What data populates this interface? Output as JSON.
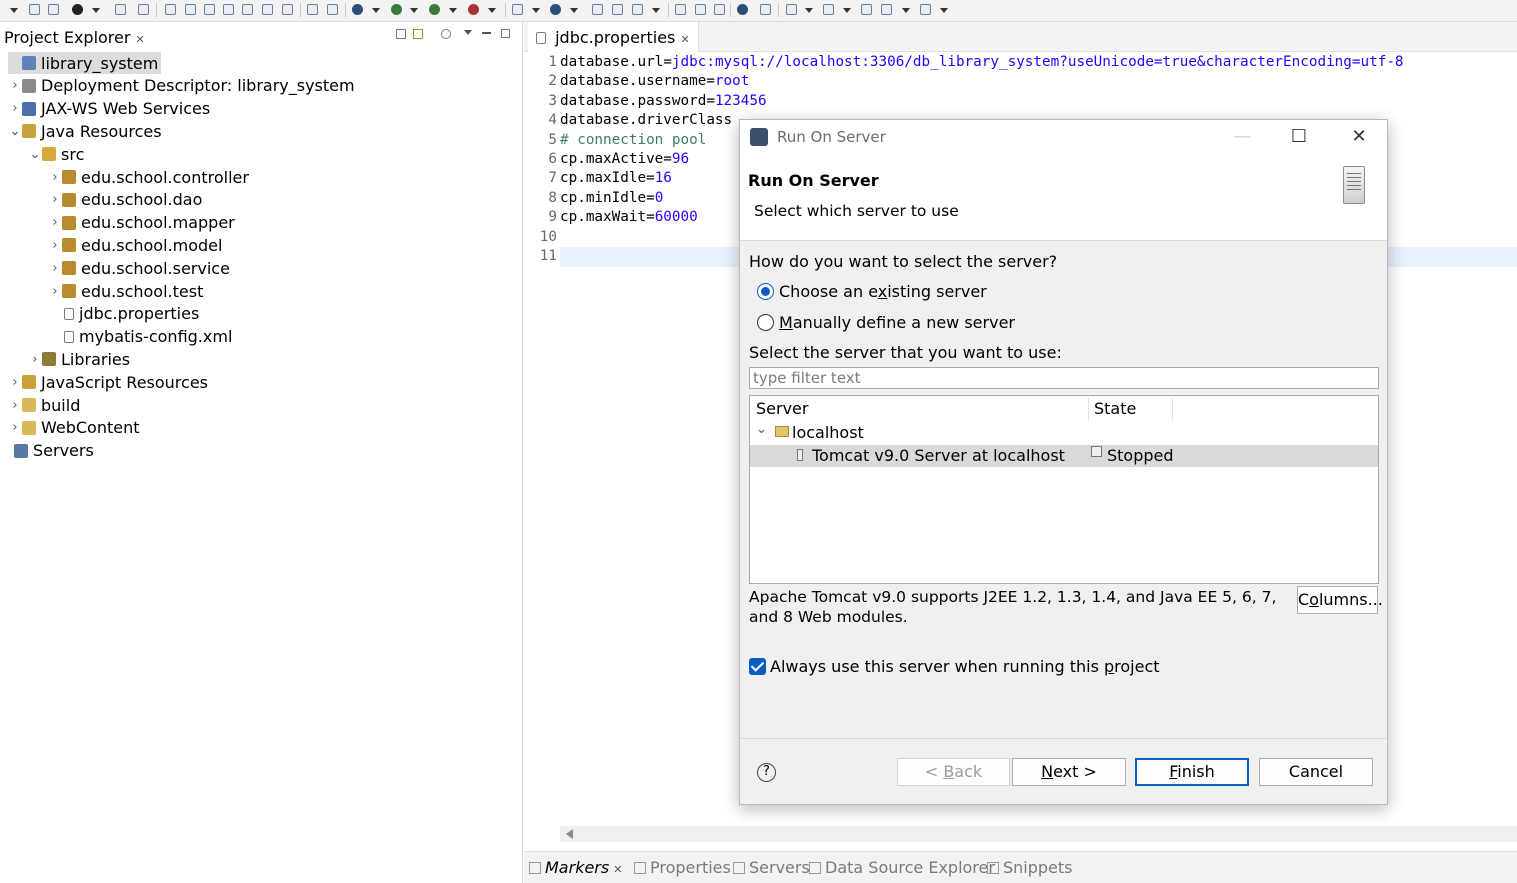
{
  "project_explorer": {
    "tab_title": "Project Explorer",
    "tree": [
      {
        "label": "library_system",
        "icon": "project-icon",
        "twisty": ""
      },
      {
        "label": "Deployment Descriptor: library_system",
        "icon": "deployment-descriptor-icon",
        "twisty": "›"
      },
      {
        "label": "JAX-WS Web Services",
        "icon": "web-services-icon",
        "twisty": "›"
      },
      {
        "label": "Java Resources",
        "icon": "java-resources-icon",
        "twisty": "⌄"
      },
      {
        "label": "src",
        "icon": "source-folder-icon",
        "twisty": "⌄"
      },
      {
        "label": "edu.school.controller",
        "icon": "package-icon",
        "twisty": "›"
      },
      {
        "label": "edu.school.dao",
        "icon": "package-icon",
        "twisty": "›"
      },
      {
        "label": "edu.school.mapper",
        "icon": "package-icon",
        "twisty": "›"
      },
      {
        "label": "edu.school.model",
        "icon": "package-icon",
        "twisty": "›"
      },
      {
        "label": "edu.school.service",
        "icon": "package-icon",
        "twisty": "›"
      },
      {
        "label": "edu.school.test",
        "icon": "package-icon",
        "twisty": "›"
      },
      {
        "label": "jdbc.properties",
        "icon": "properties-file-icon",
        "twisty": ""
      },
      {
        "label": "mybatis-config.xml",
        "icon": "xml-file-icon",
        "twisty": ""
      },
      {
        "label": "Libraries",
        "icon": "libraries-icon",
        "twisty": "›"
      },
      {
        "label": "JavaScript Resources",
        "icon": "javascript-resources-icon",
        "twisty": "›"
      },
      {
        "label": "build",
        "icon": "folder-icon",
        "twisty": "›"
      },
      {
        "label": "WebContent",
        "icon": "folder-icon",
        "twisty": "›"
      },
      {
        "label": "Servers",
        "icon": "servers-icon",
        "twisty": ""
      }
    ]
  },
  "editor": {
    "tab_title": "jdbc.properties",
    "lines": [
      {
        "num": "1",
        "key": "database.url=",
        "value": "jdbc:mysql://localhost:3306/db_library_system?useUnicode=true&characterEncoding=utf-8",
        "comment": ""
      },
      {
        "num": "2",
        "key": "database.username=",
        "value": "root",
        "comment": ""
      },
      {
        "num": "3",
        "key": "database.password=",
        "value": "123456",
        "comment": ""
      },
      {
        "num": "4",
        "key": "database.driverClass",
        "value": "",
        "comment": ""
      },
      {
        "num": "5",
        "key": "",
        "value": "",
        "comment": "# connection pool"
      },
      {
        "num": "6",
        "key": "cp.maxActive=",
        "value": "96",
        "comment": ""
      },
      {
        "num": "7",
        "key": "cp.maxIdle=",
        "value": "16",
        "comment": ""
      },
      {
        "num": "8",
        "key": "cp.minIdle=",
        "value": "0",
        "comment": ""
      },
      {
        "num": "9",
        "key": "cp.maxWait=",
        "value": "60000",
        "comment": ""
      },
      {
        "num": "10",
        "key": "",
        "value": "",
        "comment": ""
      },
      {
        "num": "11",
        "key": "",
        "value": "",
        "comment": ""
      }
    ]
  },
  "bottom_tabs": [
    {
      "label": "Markers",
      "icon": "markers-icon"
    },
    {
      "label": "Properties",
      "icon": "properties-icon"
    },
    {
      "label": "Servers",
      "icon": "servers-icon"
    },
    {
      "label": "Data Source Explorer",
      "icon": "data-source-icon"
    },
    {
      "label": "Snippets",
      "icon": "snippets-icon"
    }
  ],
  "dialog": {
    "window_title": "Run On Server",
    "heading": "Run On Server",
    "subheading": "Select which server to use",
    "question": "How do you want to select the server?",
    "radio_existing": {
      "before": "Choose an e",
      "mnemonic": "x",
      "after": "isting server",
      "selected": true
    },
    "radio_manual": {
      "before": "",
      "mnemonic": "M",
      "after": "anually define a new server",
      "selected": false
    },
    "select_label": "Select the server that you want to use:",
    "filter_placeholder": "type filter text",
    "table": {
      "col_server": "Server",
      "col_state": "State",
      "group": "localhost",
      "server_name": "Tomcat v9.0 Server at localhost",
      "server_state": "Stopped"
    },
    "description": "Apache Tomcat v9.0 supports J2EE 1.2, 1.3, 1.4, and Java EE 5, 6, 7, and 8 Web modules.",
    "columns_button": {
      "before": "C",
      "mnemonic": "o",
      "after": "lumns..."
    },
    "always_use": {
      "before": "Always use this server when running this ",
      "mnemonic": "p",
      "after": "roject",
      "checked": true
    },
    "buttons": {
      "back": {
        "before": "< ",
        "mnemonic": "B",
        "after": "ack"
      },
      "next": {
        "before": "",
        "mnemonic": "N",
        "after": "ext >"
      },
      "finish": {
        "before": "",
        "mnemonic": "F",
        "after": "inish"
      },
      "cancel": "Cancel"
    },
    "help_glyph": "?"
  },
  "colors": {
    "accent": "#0a5bc4",
    "code_value": "#2a00ff",
    "code_comment": "#3f7f5f"
  }
}
